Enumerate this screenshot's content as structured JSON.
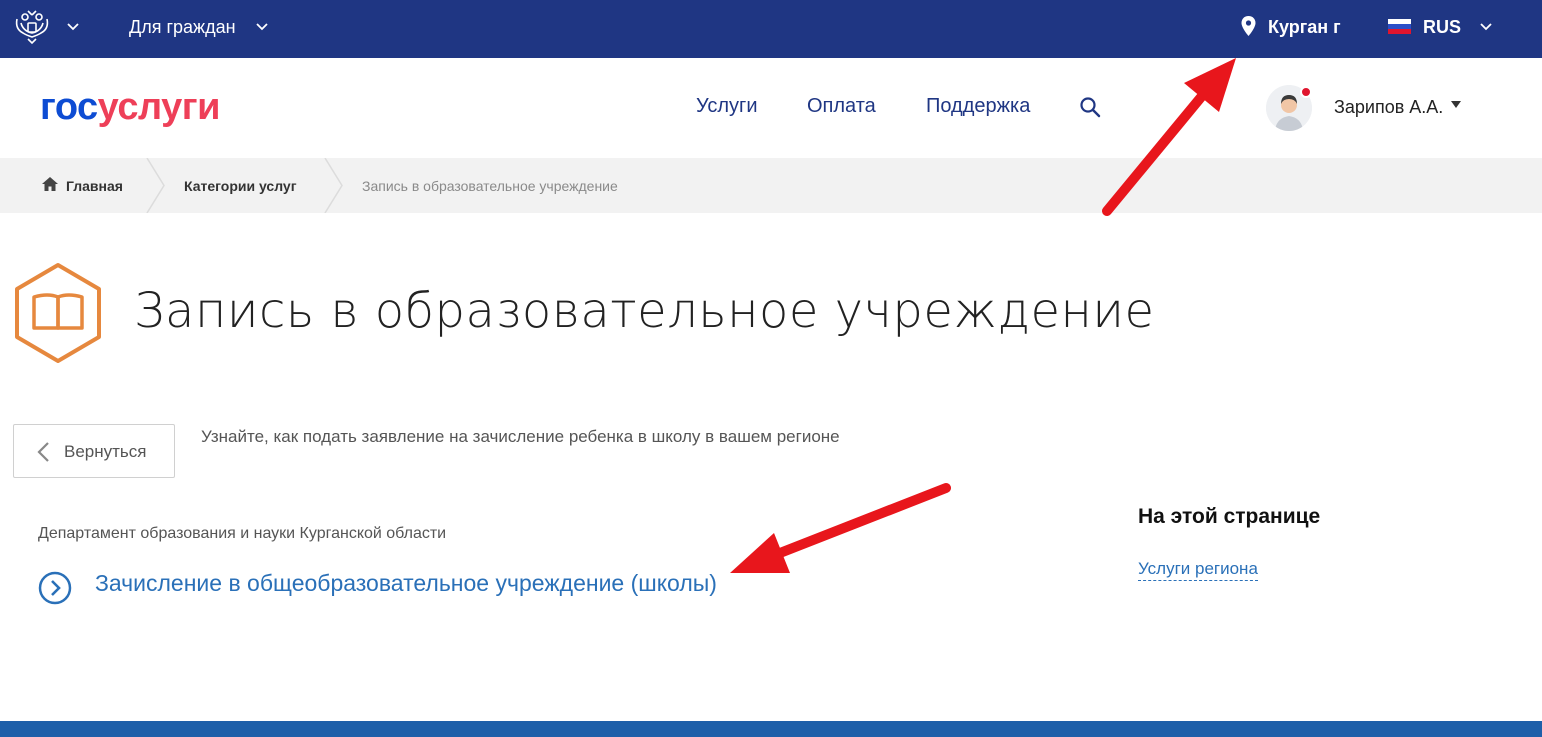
{
  "topbar": {
    "audience_label": "Для граждан",
    "location": "Курган г",
    "language": "RUS"
  },
  "header": {
    "logo_part1": "гос",
    "logo_part2": "услуги",
    "nav": [
      "Услуги",
      "Оплата",
      "Поддержка"
    ],
    "user_name": "Зарипов А.А."
  },
  "breadcrumb": {
    "home": "Главная",
    "category": "Категории услуг",
    "current": "Запись в образовательное учреждение"
  },
  "page": {
    "title": "Запись в образовательное учреждение",
    "back_label": "Вернуться",
    "intro": "Узнайте, как подать заявление на зачисление ребенка в школу в вашем регионе",
    "department": "Департамент образования и науки Курганской области",
    "service_link": "Зачисление в общеобразовательное учреждение (школы)"
  },
  "sidebar": {
    "title": "На этой странице",
    "link": "Услуги региона"
  },
  "colors": {
    "topbar": "#1f3683",
    "logo_blue": "#0d4cd3",
    "logo_red": "#ee3f58",
    "link": "#2a70b8",
    "accent_orange": "#e6883e",
    "annotation_arrow": "#e8161c"
  }
}
